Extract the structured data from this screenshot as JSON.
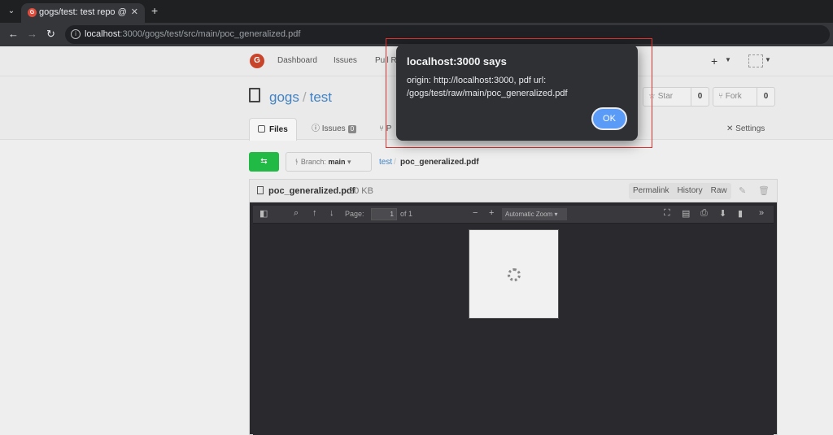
{
  "browser": {
    "tab_title": "gogs/test: test repo @ m",
    "tab_close": "✕",
    "new_tab": "+",
    "url_host": "localhost",
    "url_rest": ":3000/gogs/test/src/main/poc_generalized.pdf"
  },
  "gogs_nav": {
    "dashboard": "Dashboard",
    "issues": "Issues",
    "pulls": "Pull R",
    "plus": "+"
  },
  "repo": {
    "owner": "gogs",
    "separator": "/",
    "name": "test",
    "star_label": "Star",
    "star_count": "0",
    "fork_label": "Fork",
    "fork_count": "0"
  },
  "tabs": {
    "files": "Files",
    "issues": "Issues",
    "issues_count": "0",
    "pulls": "P",
    "settings": "Settings"
  },
  "toolbar": {
    "branch_prefix": "Branch:",
    "branch_name": "main",
    "crumb_repo": "test",
    "crumb_sep": "/",
    "crumb_file": "poc_generalized.pdf"
  },
  "file": {
    "name": "poc_generalized.pdf",
    "size": "20 KB",
    "permalink": "Permalink",
    "history": "History",
    "raw": "Raw"
  },
  "pdf": {
    "page_label": "Page:",
    "page_value": "1",
    "of_pages": "of 1",
    "zoom": "Automatic Zoom"
  },
  "dialog": {
    "title": "localhost:3000 says",
    "message": "origin: http://localhost:3000, pdf url: /gogs/test/raw/main/poc_generalized.pdf",
    "ok": "OK"
  },
  "colors": {
    "highlight": "#e0312f",
    "ok_button": "#5a9bf8",
    "green_button": "#21ba45",
    "link": "#4183c4"
  }
}
